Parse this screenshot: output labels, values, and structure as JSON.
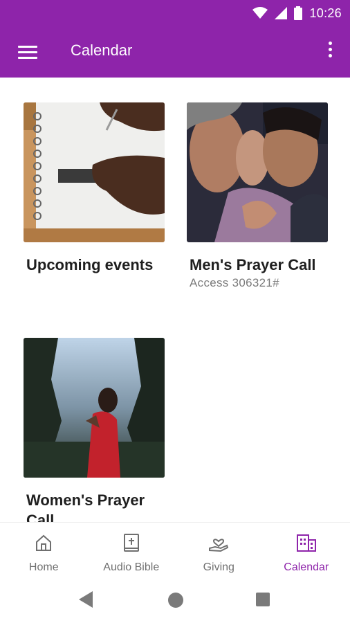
{
  "status_bar": {
    "time": "10:26"
  },
  "app_bar": {
    "title": "Calendar"
  },
  "cards": [
    {
      "title": "Upcoming events",
      "subtitle": ""
    },
    {
      "title": "Men's Prayer Call",
      "subtitle": "Access 306321#"
    },
    {
      "title": "Women's Prayer Call",
      "subtitle": ""
    }
  ],
  "bottom_nav": {
    "items": [
      {
        "label": "Home",
        "icon": "home-icon"
      },
      {
        "label": "Audio Bible",
        "icon": "bible-icon"
      },
      {
        "label": "Giving",
        "icon": "giving-icon"
      },
      {
        "label": "Calendar",
        "icon": "calendar-icon",
        "active": true
      }
    ]
  },
  "colors": {
    "primary": "#8e24aa",
    "inactive": "#6f6f6f"
  }
}
